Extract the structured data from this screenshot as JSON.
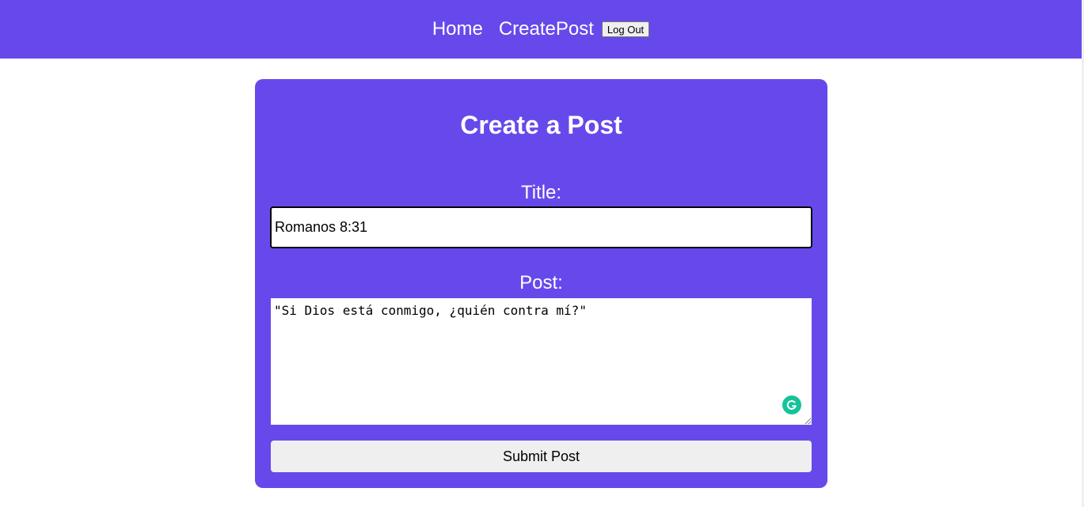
{
  "nav": {
    "home_label": "Home",
    "create_label": "CreatePost",
    "logout_label": "Log Out"
  },
  "form": {
    "heading": "Create a Post",
    "title_label": "Title:",
    "title_value": "Romanos 8:31",
    "post_label": "Post:",
    "post_value": "\"Si Dios está conmigo, ¿quién contra mí?\"",
    "submit_label": "Submit Post"
  },
  "colors": {
    "accent": "#6749eb",
    "grammarly": "#15c39a"
  },
  "icons": {
    "grammarly": "grammarly-icon"
  }
}
